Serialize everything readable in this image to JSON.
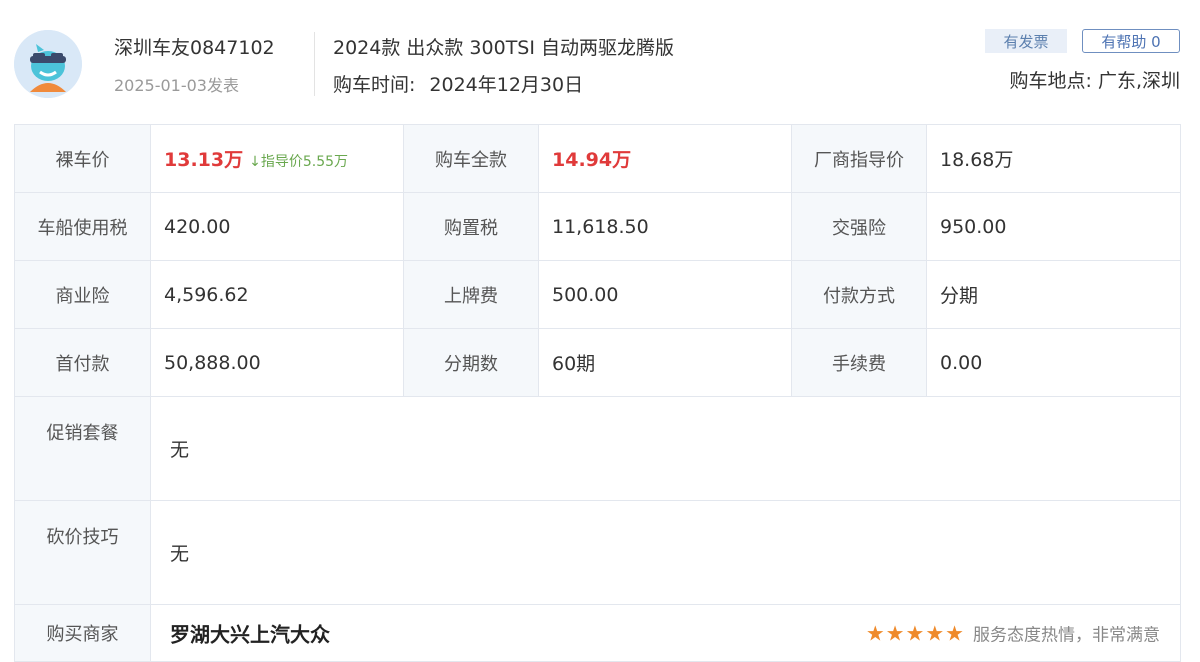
{
  "user": {
    "name": "深圳车友0847102",
    "post_date": "2025-01-03发表"
  },
  "car": {
    "model": "2024款 出众款 300TSI 自动两驱龙腾版",
    "purchase_time_label": "购车时间:",
    "purchase_time_value": "2024年12月30日",
    "purchase_place": "购车地点: 广东,深圳"
  },
  "actions": {
    "invoice_badge": "有发票",
    "helpful_button": "有帮助 0"
  },
  "table": {
    "rows": [
      [
        {
          "label": "裸车价",
          "value": "13.13万",
          "note": "↓指导价5.55万"
        },
        {
          "label": "购车全款",
          "value": "14.94万"
        },
        {
          "label": "厂商指导价",
          "value": "18.68万"
        }
      ],
      [
        {
          "label": "车船使用税",
          "value": "420.00"
        },
        {
          "label": "购置税",
          "value": "11,618.50"
        },
        {
          "label": "交强险",
          "value": "950.00"
        }
      ],
      [
        {
          "label": "商业险",
          "value": "4,596.62"
        },
        {
          "label": "上牌费",
          "value": "500.00"
        },
        {
          "label": "付款方式",
          "value": "分期"
        }
      ],
      [
        {
          "label": "首付款",
          "value": "50,888.00"
        },
        {
          "label": "分期数",
          "value": "60期"
        },
        {
          "label": "手续费",
          "value": "0.00"
        }
      ]
    ],
    "promo": {
      "label": "促销套餐",
      "value": "无"
    },
    "bargain": {
      "label": "砍价技巧",
      "value": "无"
    },
    "dealer": {
      "label": "购买商家",
      "name": "罗湖大兴上汽大众",
      "stars": "★★★★★",
      "rating": 5,
      "rating_text": "服务态度热情，非常满意"
    }
  },
  "colors": {
    "price_red": "#e03a3a",
    "note_green": "#6aa84f",
    "star_orange": "#ef8a2a",
    "link_blue": "#4d73b3"
  }
}
